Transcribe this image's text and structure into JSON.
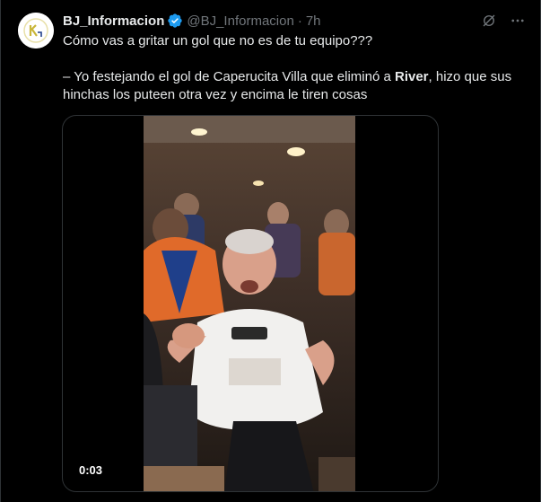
{
  "author": {
    "display_name": "BJ_Informacion",
    "handle": "@BJ_Informacion",
    "time": "7h"
  },
  "icons": {
    "verified": "verified-badge-icon",
    "grok": "grok-icon",
    "more": "more-icon"
  },
  "tweet": {
    "line1": "Cómo vas a gritar un gol que no es de tu equipo???",
    "line2_prefix": "– Yo festejando el gol de Caperucita Villa que eliminó a ",
    "line2_bold": "River",
    "line2_suffix": ", hizo que sus hinchas los puteen otra vez y encima le tiren cosas"
  },
  "video": {
    "timer": "0:03"
  },
  "colors": {
    "background": "#000000",
    "verified": "#1d9bf0",
    "muted": "#71767b"
  }
}
